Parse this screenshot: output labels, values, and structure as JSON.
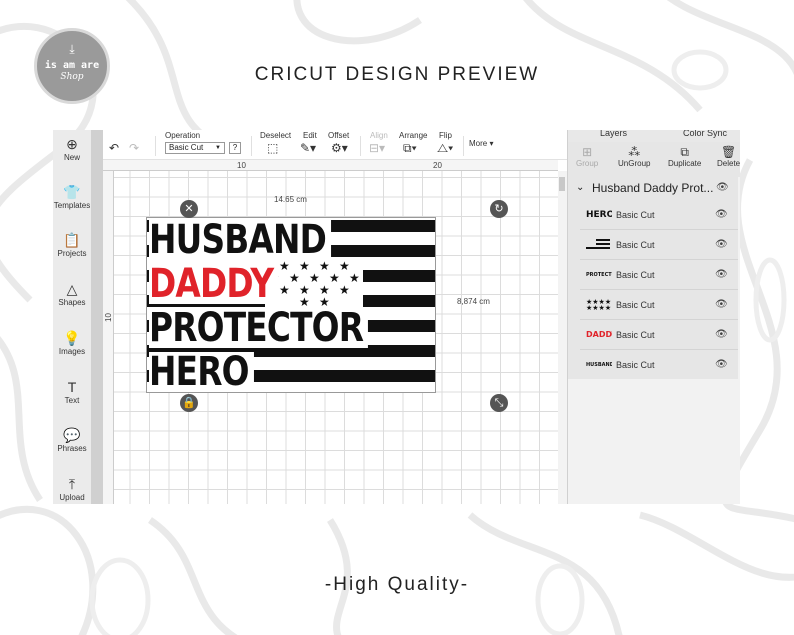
{
  "header": {
    "title": "CRICUT DESIGN PREVIEW"
  },
  "footer": {
    "quality": "-High Quality-"
  },
  "logo": {
    "name": "is am are",
    "sub": "Shop",
    "icon": "download-icon"
  },
  "left_sidebar": {
    "items": [
      {
        "label": "New",
        "icon": "plus-circle-icon"
      },
      {
        "label": "Templates",
        "icon": "shirt-icon"
      },
      {
        "label": "Projects",
        "icon": "clipboard-icon"
      },
      {
        "label": "Shapes",
        "icon": "shapes-icon"
      },
      {
        "label": "Images",
        "icon": "lightbulb-icon"
      },
      {
        "label": "Text",
        "icon": "text-icon"
      },
      {
        "label": "Phrases",
        "icon": "speech-bubble-icon"
      },
      {
        "label": "Upload",
        "icon": "upload-icon"
      }
    ]
  },
  "toolbar": {
    "operation_label": "Operation",
    "operation_value": "Basic Cut",
    "help": "?",
    "deselect": "Deselect",
    "edit": "Edit",
    "offset": "Offset",
    "align": "Align",
    "arrange": "Arrange",
    "flip": "Flip",
    "more": "More"
  },
  "rulers": {
    "top_marks": [
      "10",
      "20"
    ],
    "left_marks": [
      "10"
    ]
  },
  "canvas": {
    "width_label": "14.65 cm",
    "height_label": "8,874 cm",
    "design_words": [
      "HUSBAND",
      "DADDY",
      "PROTECTOR",
      "HERO"
    ],
    "accent_color": "#e0232a"
  },
  "layers_panel": {
    "tabs": [
      "Layers",
      "Color Sync"
    ],
    "tools": [
      "Group",
      "UnGroup",
      "Duplicate",
      "Delete"
    ],
    "group_name": "Husband Daddy Prot...",
    "layers": [
      {
        "thumb": "HERO",
        "name": "Basic Cut"
      },
      {
        "thumb": "",
        "name": "Basic Cut"
      },
      {
        "thumb": "PROTECTOR",
        "name": "Basic Cut"
      },
      {
        "thumb": "",
        "name": "Basic Cut"
      },
      {
        "thumb": "DADDY",
        "name": "Basic Cut"
      },
      {
        "thumb": "HUSBAND",
        "name": "Basic Cut"
      }
    ]
  }
}
